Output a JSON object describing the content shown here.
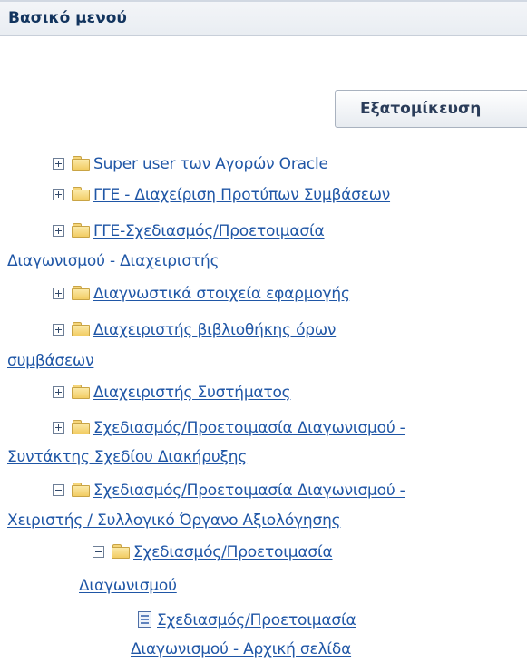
{
  "panel": {
    "title": "Βασικό μενού"
  },
  "personalize_button": {
    "label": "Εξατομίκευση"
  },
  "tree": {
    "items": [
      {
        "label": "Super user των Αγορών Oracle",
        "icon": "plus-expand-icon"
      },
      {
        "label": "ΓΓΕ - Διαχείριση Προτύπων Συμβάσεων",
        "icon": "plus-expand-icon"
      },
      {
        "label_line1": "ΓΓΕ-Σχεδιασμός/Προετοιμασία",
        "label_line2": "Διαγωνισμού - Διαχειριστής",
        "icon": "plus-expand-icon"
      },
      {
        "label": "Διαγνωστικά στοιχεία εφαρμογής",
        "icon": "plus-expand-icon"
      },
      {
        "label_line1": "Διαχειριστής βιβλιοθήκης όρων",
        "label_line2": "συμβάσεων",
        "icon": "plus-expand-icon"
      },
      {
        "label": "Διαχειριστής Συστήματος",
        "icon": "plus-expand-icon"
      },
      {
        "label_line1": "Σχεδιασμός/Προετοιμασία Διαγωνισμού -",
        "label_line2": "Συντάκτης Σχεδίου Διακήρυξης",
        "icon": "plus-expand-icon"
      },
      {
        "label_line1": "Σχεδιασμός/Προετοιμασία Διαγωνισμού -",
        "label_line2": "Χειριστής / Συλλογικό Όργανο Αξιολόγησης",
        "icon": "minus-collapse-icon",
        "children": [
          {
            "label_line1": "Σχεδιασμός/Προετοιμασία",
            "label_line2": "Διαγωνισμού",
            "icon": "minus-collapse-icon",
            "children": [
              {
                "label_line1": "Σχεδιασμός/Προετοιμασία",
                "label_line2": "Διαγωνισμού - Αρχική σελίδα",
                "icon": "page-icon"
              }
            ]
          }
        ]
      }
    ]
  }
}
